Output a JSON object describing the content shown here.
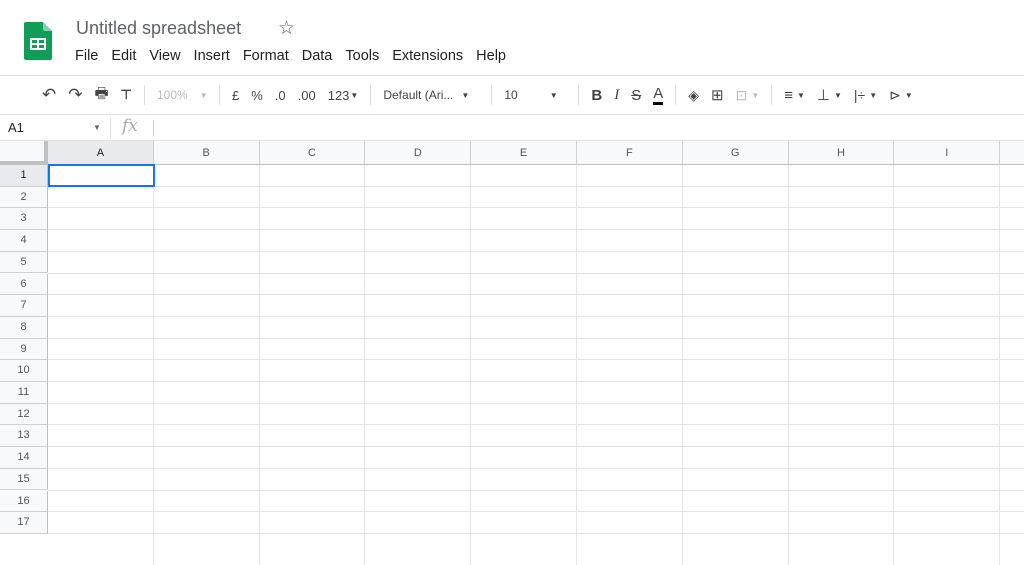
{
  "app": {
    "title": "Untitled spreadsheet",
    "brand_color": "#0f9d58"
  },
  "menu": [
    "File",
    "Edit",
    "View",
    "Insert",
    "Format",
    "Data",
    "Tools",
    "Extensions",
    "Help"
  ],
  "toolbar": {
    "zoom": "100%",
    "currency": "£",
    "percent": "%",
    "dec_decrease": ".0",
    "dec_increase": ".00",
    "more_formats": "123",
    "font": "Default (Ari...",
    "font_size": "10",
    "bold": "B",
    "italic": "I",
    "strike": "S",
    "text_color": "A"
  },
  "formula_bar": {
    "name_box": "A1",
    "fx": "fx",
    "value": ""
  },
  "columns": [
    "A",
    "B",
    "C",
    "D",
    "E",
    "F",
    "G",
    "H",
    "I"
  ],
  "rows": [
    "1",
    "2",
    "3",
    "4",
    "5",
    "6",
    "7",
    "8",
    "9",
    "10",
    "11",
    "12",
    "13",
    "14",
    "15",
    "16",
    "17"
  ],
  "selected_cell": "A1",
  "selection_color": "#1a73e8"
}
